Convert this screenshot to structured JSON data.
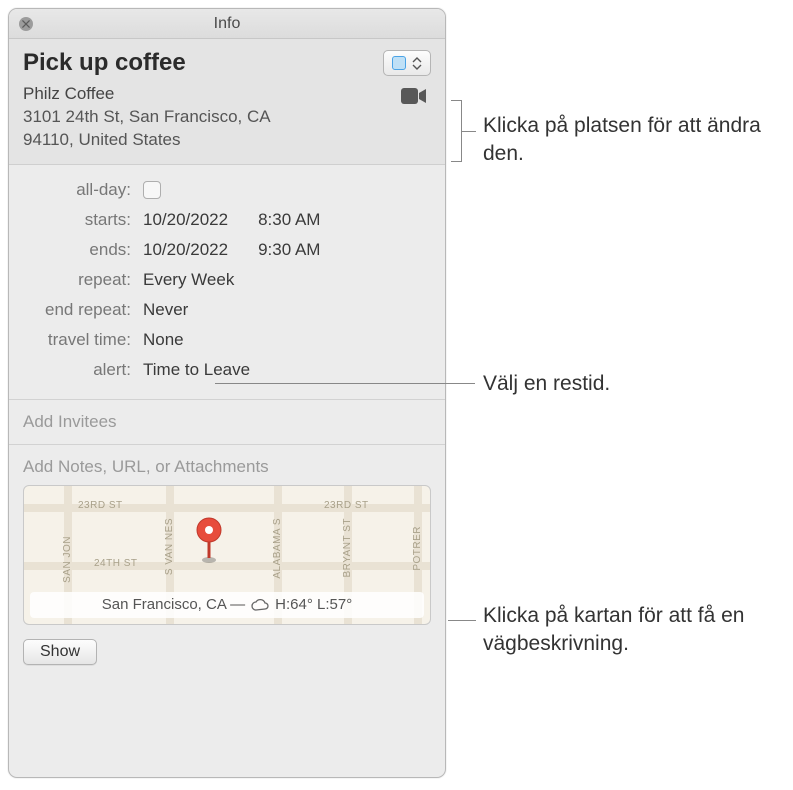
{
  "window": {
    "title": "Info"
  },
  "event": {
    "title": "Pick up coffee",
    "location_name": "Philz Coffee",
    "address_line1": "3101 24th St, San Francisco, CA",
    "address_line2": "94110, United States"
  },
  "fields": {
    "allday_label": "all-day:",
    "starts_label": "starts:",
    "starts_date": "10/20/2022",
    "starts_time": "8:30 AM",
    "ends_label": "ends:",
    "ends_date": "10/20/2022",
    "ends_time": "9:30 AM",
    "repeat_label": "repeat:",
    "repeat_value": "Every Week",
    "end_repeat_label": "end repeat:",
    "end_repeat_value": "Never",
    "travel_label": "travel time:",
    "travel_value": "None",
    "alert_label": "alert:",
    "alert_value": "Time to Leave"
  },
  "invitees_placeholder": "Add Invitees",
  "notes_placeholder": "Add Notes, URL, or Attachments",
  "map": {
    "streets": {
      "23rd_a": "23RD ST",
      "23rd_b": "23RD ST",
      "24th": "24TH ST",
      "svanness": "S VAN NES",
      "alabama": "ALABAMA S",
      "bryant": "BRYANT ST",
      "potrer": "POTRER",
      "sanjon": "SAN JON"
    },
    "weather_city": "San Francisco, CA — ",
    "weather_temps": "H:64° L:57°"
  },
  "footer": {
    "show": "Show"
  },
  "annotations": {
    "location": "Klicka på platsen för att ändra den.",
    "travel": "Välj en restid.",
    "map": "Klicka på kartan för att få en vägbeskrivning."
  }
}
